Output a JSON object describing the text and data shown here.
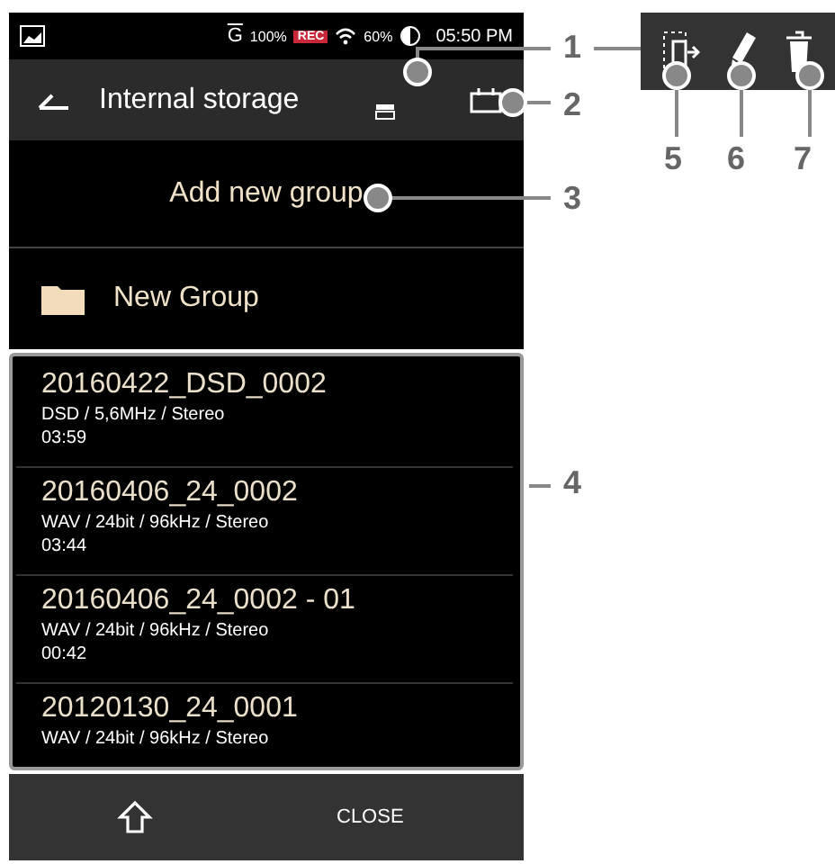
{
  "status_bar": {
    "g_label": "G",
    "battery": "100%",
    "rec": "REC",
    "wifi": "60%",
    "time": "05:50 PM"
  },
  "header": {
    "title": "Internal storage"
  },
  "add_group": {
    "label": "Add new group"
  },
  "folder": {
    "name": "New Group"
  },
  "tracks": [
    {
      "title": "20160422_DSD_0002",
      "format": "DSD / 5,6MHz / Stereo",
      "duration": "03:59"
    },
    {
      "title": "20160406_24_0002",
      "format": "WAV / 24bit / 96kHz / Stereo",
      "duration": "03:44"
    },
    {
      "title": "20160406_24_0002 - 01",
      "format": "WAV / 24bit / 96kHz / Stereo",
      "duration": "00:42"
    },
    {
      "title": "20120130_24_0001",
      "format": "WAV / 24bit / 96kHz / Stereo"
    }
  ],
  "bottom_bar": {
    "close": "CLOSE"
  },
  "callouts": [
    "1",
    "2",
    "3",
    "4",
    "5",
    "6",
    "7"
  ]
}
